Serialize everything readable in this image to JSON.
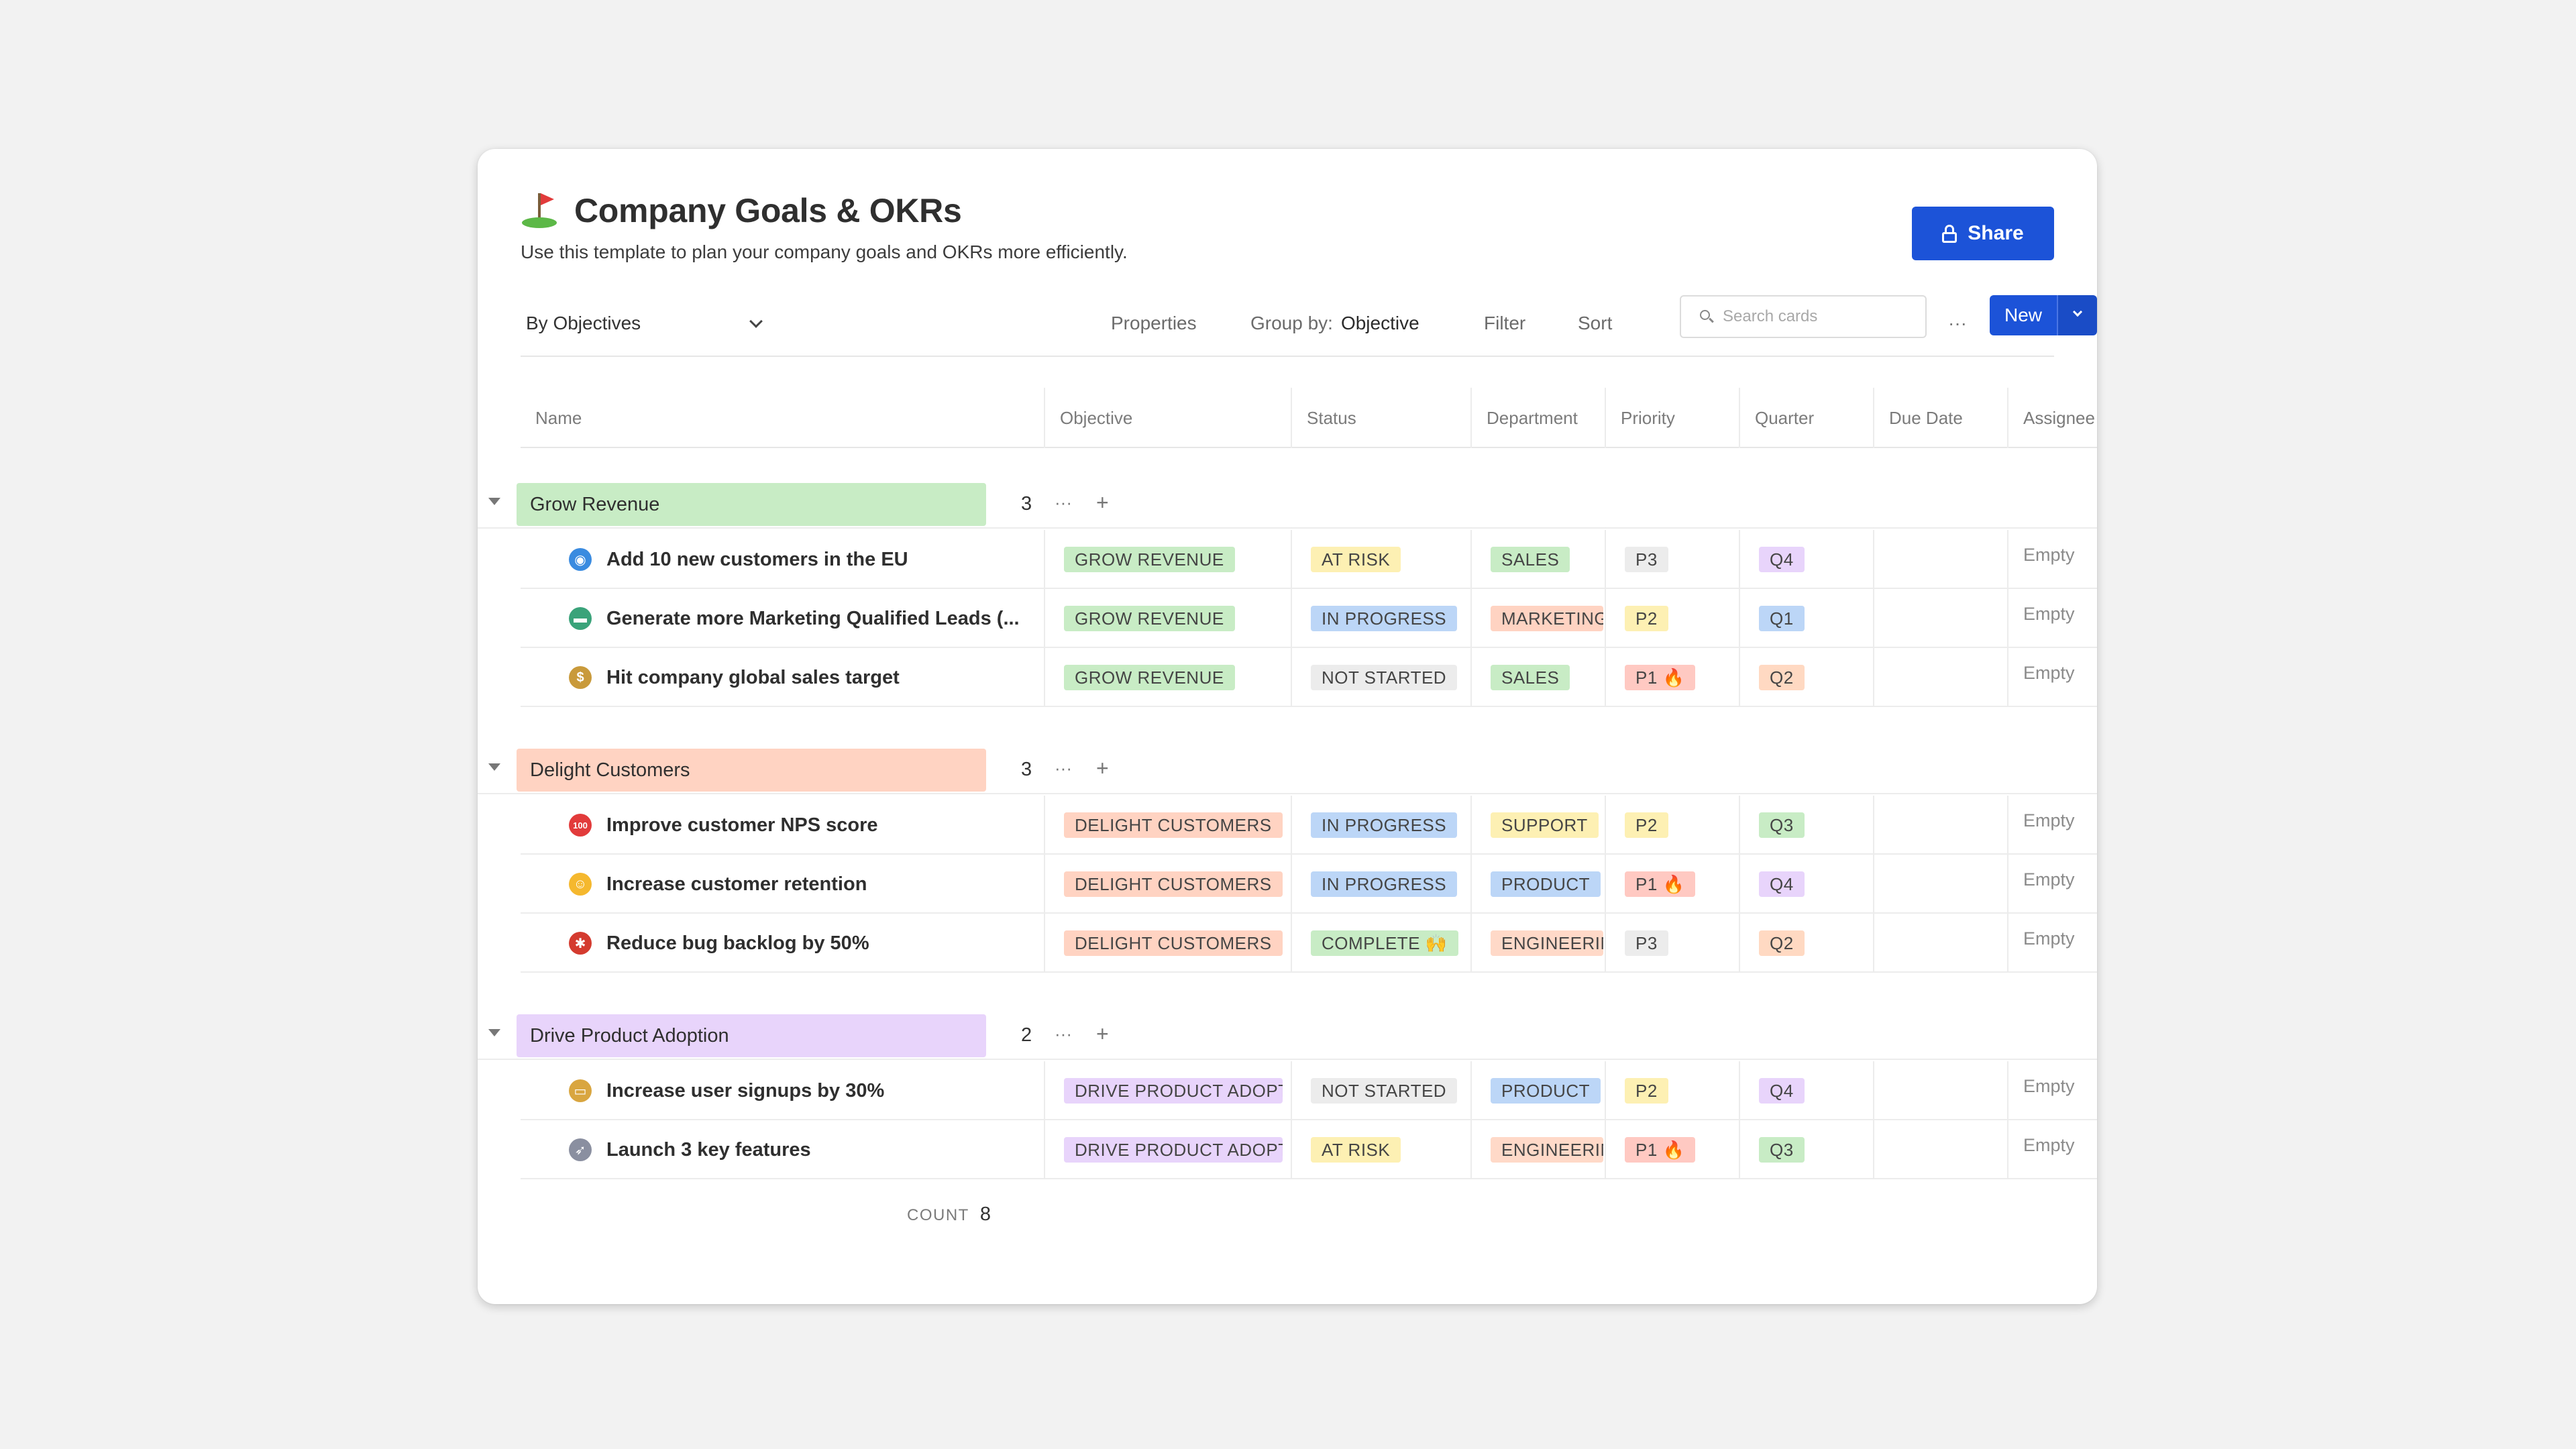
{
  "page": {
    "title": "Company Goals & OKRs",
    "title_icon": "golf-flag-icon",
    "subtitle": "Use this template to plan your company goals and OKRs more efficiently.",
    "share_label": "Share"
  },
  "toolbar": {
    "view": "By Objectives",
    "properties": "Properties",
    "group_by_label": "Group by:",
    "group_by_value": "Objective",
    "filter": "Filter",
    "sort": "Sort",
    "search_placeholder": "Search cards",
    "more": "···",
    "new_label": "New"
  },
  "columns": [
    "Name",
    "Objective",
    "Status",
    "Department",
    "Priority",
    "Quarter",
    "Due Date",
    "Assignee"
  ],
  "groups": [
    {
      "label": "Grow Revenue",
      "count": "3",
      "color": "#c8ecc5",
      "rows": [
        {
          "icon": "globe-icon",
          "name": "Add 10 new customers in the EU",
          "objective": "GROW REVENUE",
          "status": "AT RISK",
          "department": "SALES",
          "priority": "P3",
          "quarter": "Q4",
          "assignee": "Empty"
        },
        {
          "icon": "car-icon",
          "name": "Generate more Marketing Qualified Leads (...",
          "objective": "GROW REVENUE",
          "status": "IN PROGRESS",
          "department": "MARKETING",
          "priority": "P2",
          "quarter": "Q1",
          "assignee": "Empty"
        },
        {
          "icon": "money-bag-icon",
          "name": "Hit company global sales target",
          "objective": "GROW REVENUE",
          "status": "NOT STARTED",
          "department": "SALES",
          "priority": "P1 🔥",
          "quarter": "Q2",
          "assignee": "Empty"
        }
      ]
    },
    {
      "label": "Delight Customers",
      "count": "3",
      "color": "#ffd3c2",
      "rows": [
        {
          "icon": "hundred-points-icon",
          "name": "Improve customer NPS score",
          "objective": "DELIGHT CUSTOMERS",
          "status": "IN PROGRESS",
          "department": "SUPPORT",
          "priority": "P2",
          "quarter": "Q3",
          "assignee": "Empty"
        },
        {
          "icon": "grinning-face-icon",
          "name": "Increase customer retention",
          "objective": "DELIGHT CUSTOMERS",
          "status": "IN PROGRESS",
          "department": "PRODUCT",
          "priority": "P1 🔥",
          "quarter": "Q4",
          "assignee": "Empty"
        },
        {
          "icon": "ladybug-icon",
          "name": "Reduce bug backlog by 50%",
          "objective": "DELIGHT CUSTOMERS",
          "status": "COMPLETE 🙌",
          "department": "ENGINEERING",
          "priority": "P3",
          "quarter": "Q2",
          "assignee": "Empty"
        }
      ]
    },
    {
      "label": "Drive Product Adoption",
      "count": "2",
      "color": "#e8d4fb",
      "rows": [
        {
          "icon": "credit-card-icon",
          "name": "Increase user signups by 30%",
          "objective": "DRIVE PRODUCT ADOPTION",
          "status": "NOT STARTED",
          "department": "PRODUCT",
          "priority": "P2",
          "quarter": "Q4",
          "assignee": "Empty"
        },
        {
          "icon": "rocket-icon",
          "name": "Launch 3 key features",
          "objective": "DRIVE PRODUCT ADOPTION",
          "status": "AT RISK",
          "department": "ENGINEERING",
          "priority": "P1 🔥",
          "quarter": "Q3",
          "assignee": "Empty"
        }
      ]
    }
  ],
  "footer": {
    "count_label": "COUNT",
    "count_value": "8"
  },
  "tag_colors": {
    "objective": {
      "GROW REVENUE": "#c8ecc5",
      "DELIGHT CUSTOMERS": "#ffd3c2",
      "DRIVE PRODUCT ADOPTION": "#e8d4fb"
    },
    "status": {
      "AT RISK": "#fdf0b3",
      "IN PROGRESS": "#bcd6f7",
      "NOT STARTED": "#ececec",
      "COMPLETE 🙌": "#c8ecc5"
    },
    "department": {
      "SALES": "#c8ecc5",
      "MARKETING": "#ffd3c2",
      "SUPPORT": "#fdf0b3",
      "PRODUCT": "#bcd6f7",
      "ENGINEERING": "#ffd9c8"
    },
    "priority": {
      "P1 🔥": "#ffc9c2",
      "P2": "#fdf0b3",
      "P3": "#ececec"
    },
    "quarter": {
      "Q1": "#bcd6f7",
      "Q2": "#ffd9c2",
      "Q3": "#c8ecc5",
      "Q4": "#e8d4fb"
    }
  },
  "icon_colors": {
    "globe-icon": "#3a8be0",
    "car-icon": "#3aa37a",
    "money-bag-icon": "#c99a3b",
    "hundred-points-icon": "#e23b3b",
    "grinning-face-icon": "#f5b82e",
    "ladybug-icon": "#d43b2f",
    "credit-card-icon": "#d9a640",
    "rocket-icon": "#8a8fa0"
  },
  "icon_glyphs": {
    "globe-icon": "◉",
    "car-icon": "▬",
    "money-bag-icon": "$",
    "hundred-points-icon": "100",
    "grinning-face-icon": "☺",
    "ladybug-icon": "✱",
    "credit-card-icon": "▭",
    "rocket-icon": "➶"
  }
}
